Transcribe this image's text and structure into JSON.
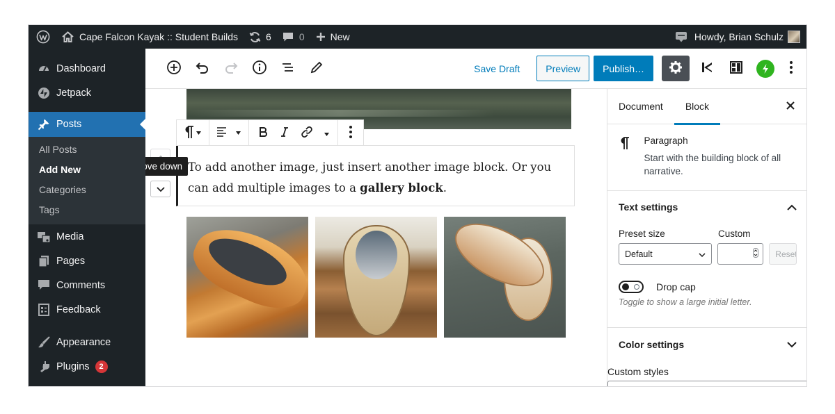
{
  "admin_bar": {
    "site_name": "Cape Falcon Kayak :: Student Builds",
    "updates_count": "6",
    "comments_count": "0",
    "new_label": "New",
    "howdy": "Howdy, Brian Schulz"
  },
  "sidebar": {
    "dashboard": "Dashboard",
    "jetpack": "Jetpack",
    "posts": "Posts",
    "all_posts": "All Posts",
    "add_new": "Add New",
    "categories": "Categories",
    "tags": "Tags",
    "media": "Media",
    "pages": "Pages",
    "comments": "Comments",
    "feedback": "Feedback",
    "appearance": "Appearance",
    "plugins": "Plugins",
    "plugins_badge": "2"
  },
  "header": {
    "save_draft": "Save Draft",
    "preview": "Preview",
    "publish": "Publish…"
  },
  "editor": {
    "tooltip": "Move down",
    "paragraph_start": "To add another image, just insert another image block. Or you can add multiple images to a ",
    "paragraph_bold": "gallery block",
    "paragraph_end": "."
  },
  "settings": {
    "tab_document": "Document",
    "tab_block": "Block",
    "block_title": "Paragraph",
    "block_desc": "Start with the building block of all narrative.",
    "text_settings": "Text settings",
    "preset_size_label": "Preset size",
    "custom_label": "Custom",
    "preset_value": "Default",
    "reset_label": "Reset",
    "drop_cap_label": "Drop cap",
    "drop_cap_help": "Toggle to show a large initial letter.",
    "color_settings": "Color settings",
    "custom_styles": "Custom styles"
  },
  "colors": {
    "admin_dark": "#1d2327",
    "accent": "#007cba",
    "current_menu": "#2271b1",
    "badge": "#d63638",
    "jetpack_green": "#2fb41f"
  },
  "icons": {
    "admin_bar": [
      "wordpress-logo-icon",
      "home-icon",
      "updates-icon",
      "comment-icon",
      "plus-icon",
      "chat-icon"
    ],
    "toolbar": [
      "add-block-icon",
      "undo-icon",
      "redo-icon",
      "info-icon",
      "list-view-icon",
      "tools-pencil-icon",
      "settings-gear-icon",
      "kadence-icon",
      "blocks-grid-icon",
      "jetpack-icon",
      "more-vertical-icon"
    ]
  }
}
